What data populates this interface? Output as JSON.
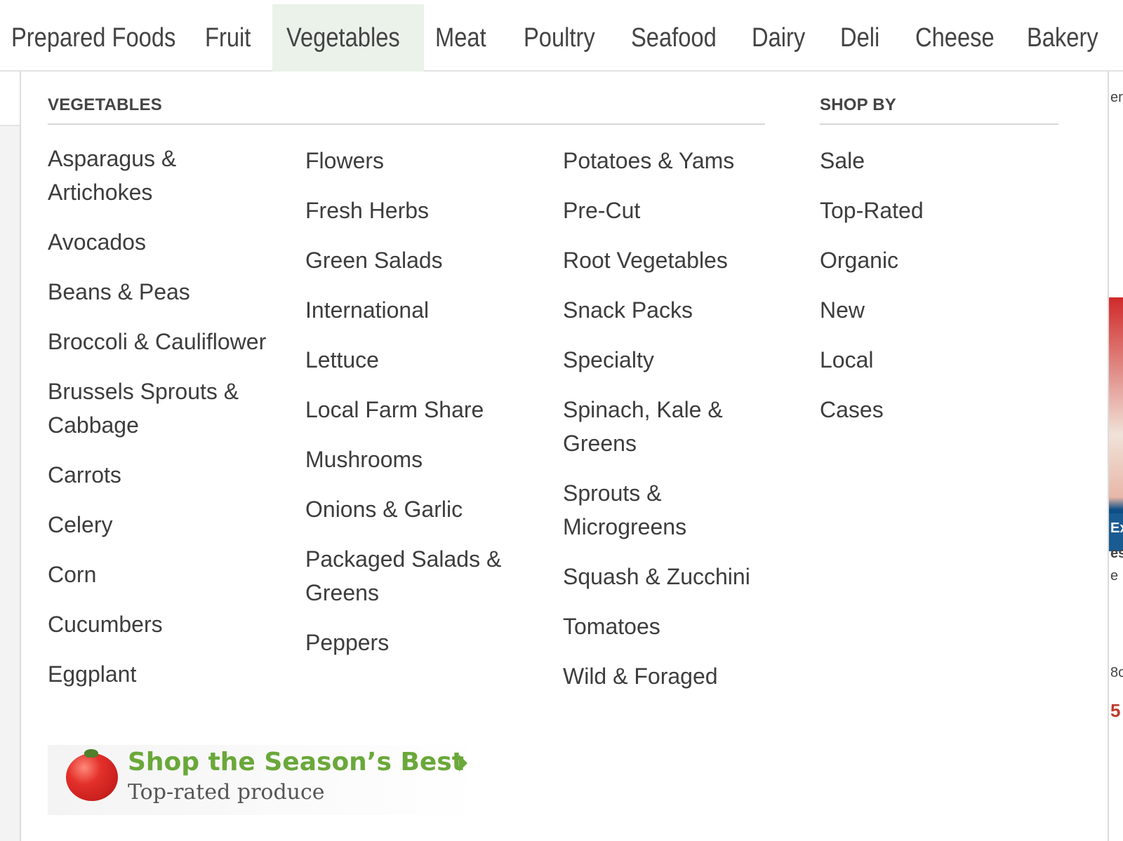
{
  "nav": {
    "items": [
      "Prepared Foods",
      "Fruit",
      "Vegetables",
      "Meat",
      "Poultry",
      "Seafood",
      "Dairy",
      "Deli",
      "Cheese",
      "Bakery"
    ],
    "active": "Vegetables"
  },
  "dropdown": {
    "vegetables_title": "VEGETABLES",
    "shopby_title": "SHOP BY",
    "col1": [
      "Asparagus & Artichokes",
      "Avocados",
      "Beans & Peas",
      "Broccoli & Cauliflower",
      "Brussels Sprouts & Cabbage",
      "Carrots",
      "Celery",
      "Corn",
      "Cucumbers",
      "Eggplant"
    ],
    "col2": [
      "Flowers",
      "Fresh Herbs",
      "Green Salads",
      "International",
      "Lettuce",
      "Local Farm Share",
      "Mushrooms",
      "Onions & Garlic",
      "Packaged Salads & Greens",
      "Peppers"
    ],
    "col3": [
      "Potatoes & Yams",
      "Pre-Cut",
      "Root Vegetables",
      "Snack Packs",
      "Specialty",
      "Spinach, Kale & Greens",
      "Sprouts & Microgreens",
      "Squash & Zucchini",
      "Tomatoes",
      "Wild & Foraged"
    ],
    "shop_by": [
      "Sale",
      "Top-Rated",
      "Organic",
      "New",
      "Local",
      "Cases"
    ]
  },
  "banner": {
    "title": "Shop the Season’s Best",
    "subtitle": "Top-rated produce"
  },
  "right_strip": {
    "t1": "er",
    "t2": "Ex",
    "t3": "es",
    "t4": "e",
    "t5": "8c",
    "t6": "5"
  },
  "colors": {
    "active_tab_bg": "#eaf2ea",
    "banner_green": "#6aa83a",
    "link_text": "#3d3d3d"
  }
}
